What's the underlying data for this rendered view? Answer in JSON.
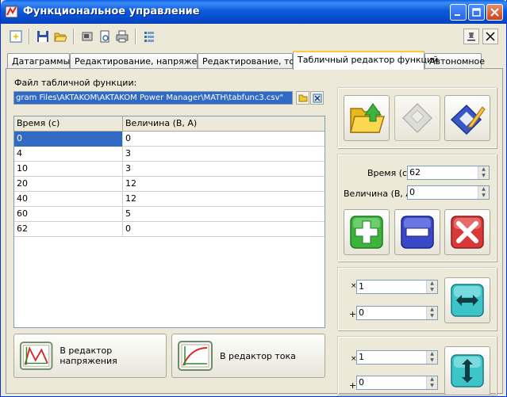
{
  "window": {
    "title": "Функциональное управление"
  },
  "tabs": [
    {
      "label": "Датаграммы"
    },
    {
      "label": "Редактирование, напряжение"
    },
    {
      "label": "Редактирование, ток"
    },
    {
      "label": "Табличный редактор функций"
    },
    {
      "label": "Автономное"
    }
  ],
  "file": {
    "label": "Файл табличной функции:",
    "value": "gram Files\\AKTAKOM\\AKTAKOM Power Manager\\MATH\\tabfunc3.csv\""
  },
  "table": {
    "columns": [
      "Время (c)",
      "Величина (В, А)"
    ],
    "rows": [
      [
        "0",
        "0"
      ],
      [
        "4",
        "3"
      ],
      [
        "10",
        "3"
      ],
      [
        "20",
        "12"
      ],
      [
        "40",
        "12"
      ],
      [
        "60",
        "5"
      ],
      [
        "62",
        "0"
      ]
    ],
    "selected_row": 0
  },
  "editor": {
    "time_label": "Время (c)",
    "time_value": "62",
    "value_label": "Величина (В, А)",
    "value_value": "0"
  },
  "scale_x": {
    "mul_sign": "×",
    "mul_value": "1",
    "add_sign": "+",
    "add_value": "0"
  },
  "scale_y": {
    "mul_sign": "×",
    "mul_value": "1",
    "add_sign": "+",
    "add_value": "0"
  },
  "buttons": {
    "to_voltage": "В редактор напряжения",
    "to_current": "В редактор тока"
  },
  "colors": {
    "title_bar": "#0A5FE8",
    "selection": "#316AC5",
    "add": "#3CB43C",
    "remove": "#3A48C8",
    "delete": "#D83838",
    "arrow": "#3CC4C8"
  }
}
